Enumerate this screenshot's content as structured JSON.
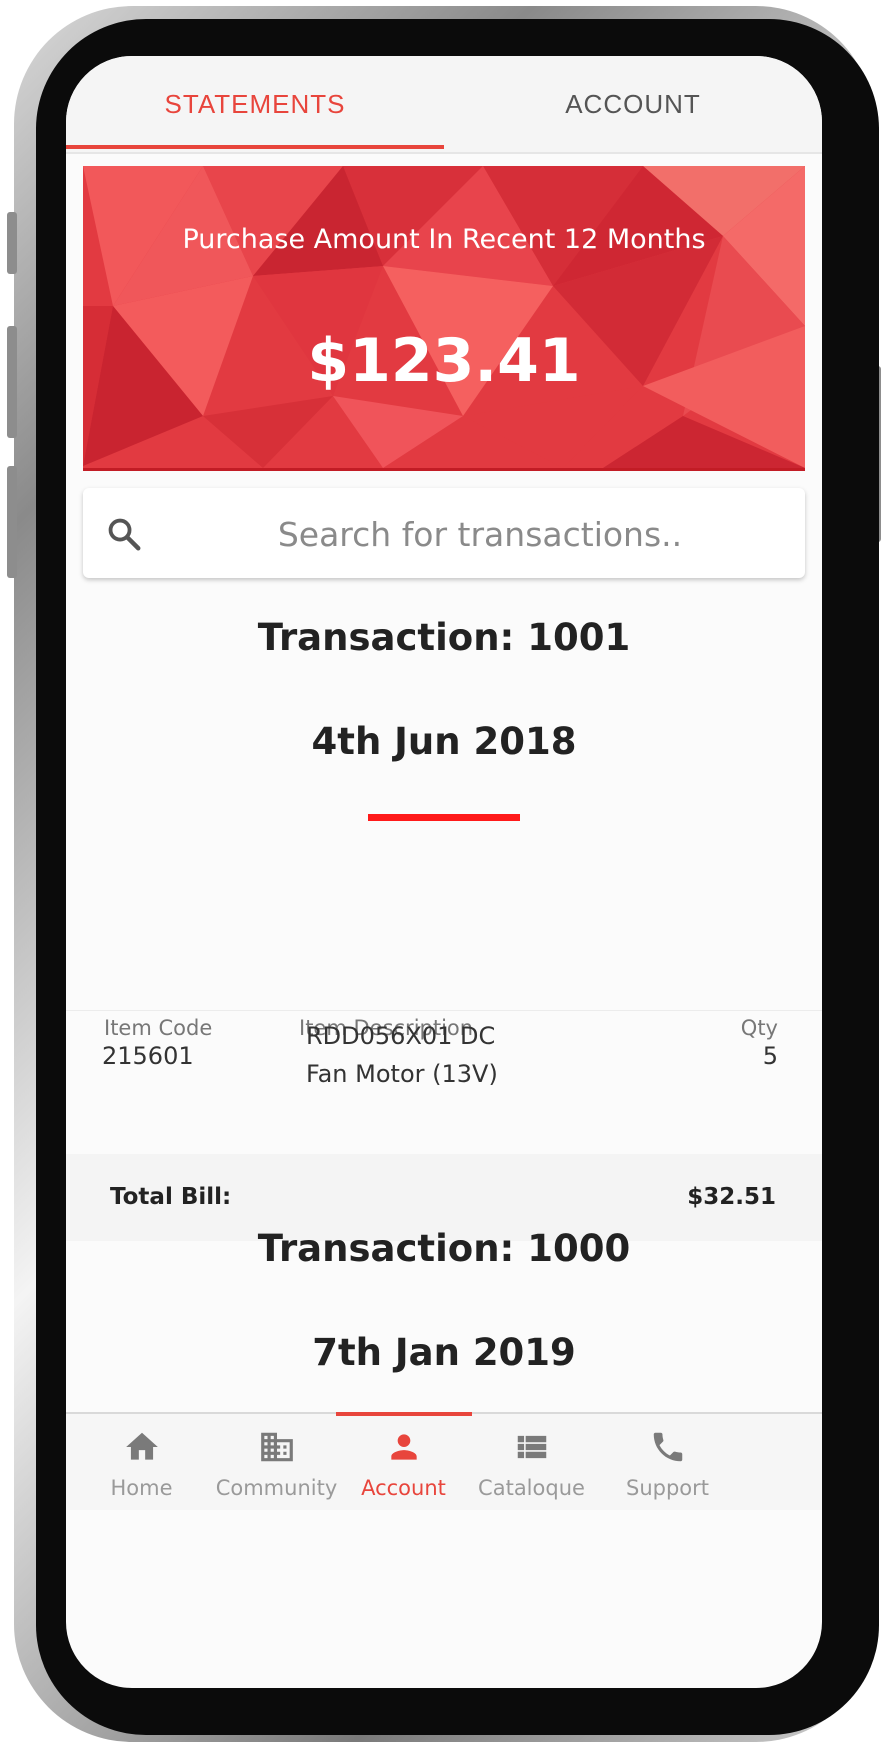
{
  "tabs": {
    "statements": "STATEMENTS",
    "account": "ACCOUNT"
  },
  "banner": {
    "title": "Purchase Amount In Recent 12 Months",
    "amount": "$123.41",
    "accent_color": "#e23a41"
  },
  "search": {
    "placeholder": "Search for transactions.."
  },
  "transactions": [
    {
      "title": "Transaction: 1001",
      "date": "4th Jun 2018",
      "columns": {
        "code": "Item Code",
        "description": "Item Description",
        "qty": "Qty"
      },
      "items": [
        {
          "code": "215601",
          "description_line1": "RDD056X01 DC",
          "description_line2": "Fan Motor (13V)",
          "qty": "5"
        }
      ],
      "total_label": "Total Bill:",
      "total_value": "$32.51"
    },
    {
      "title": "Transaction: 1000",
      "date": "7th Jan 2019"
    }
  ],
  "bottom_nav": [
    {
      "label": "Home",
      "icon": "home-icon"
    },
    {
      "label": "Community",
      "icon": "building-icon"
    },
    {
      "label": "Account",
      "icon": "person-icon",
      "active": true
    },
    {
      "label": "Cataloque",
      "icon": "list-icon"
    },
    {
      "label": "Support",
      "icon": "phone-icon"
    }
  ],
  "colors": {
    "accent": "#e8453c",
    "divider": "#ff1a1a"
  }
}
